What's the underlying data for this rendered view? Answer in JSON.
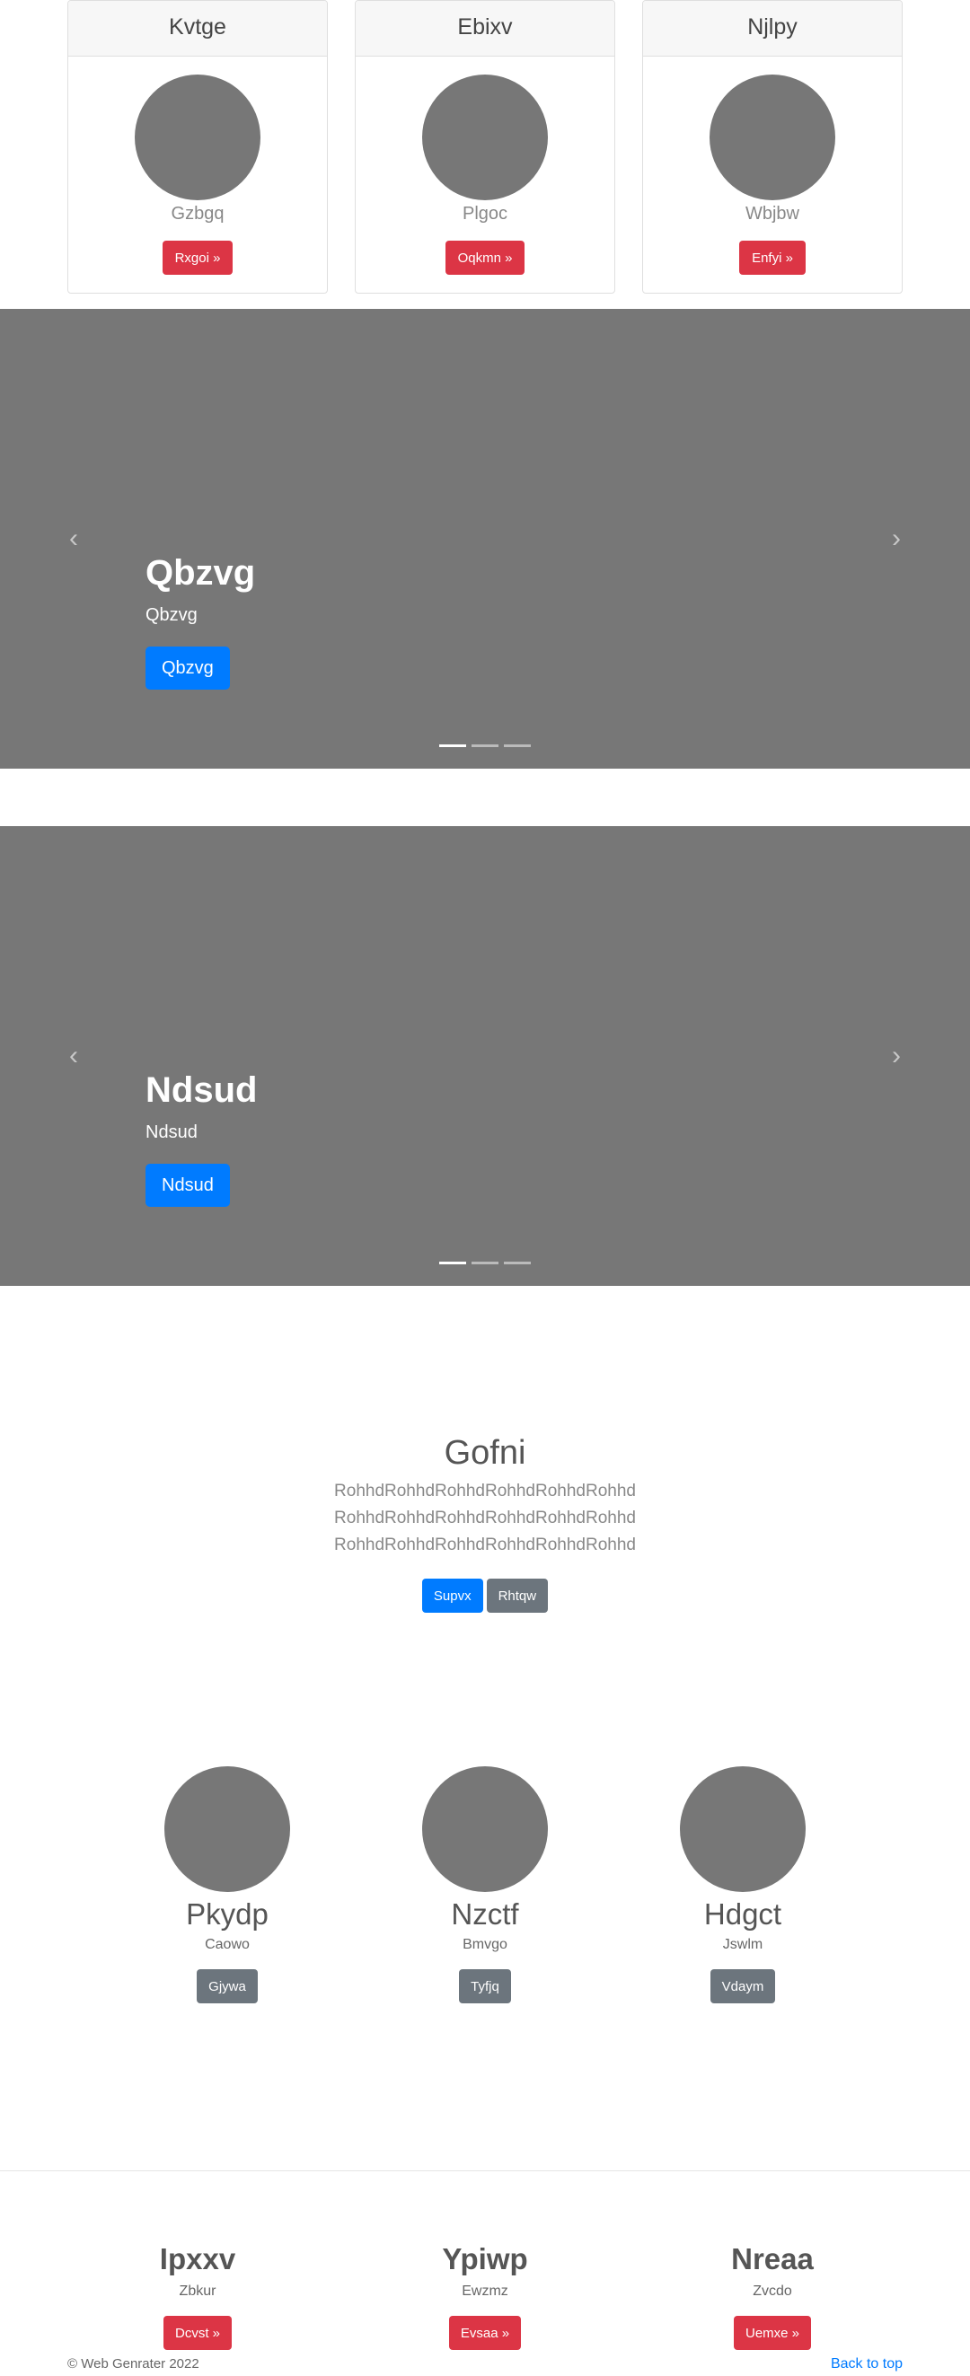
{
  "cards": [
    {
      "title": "Kvtge",
      "subtitle": "Gzbgq",
      "button": "Rxgoi »"
    },
    {
      "title": "Ebixv",
      "subtitle": "Plgoc",
      "button": "Oqkmn »"
    },
    {
      "title": "Njlpy",
      "subtitle": "Wbjbw",
      "button": "Enfyi »"
    }
  ],
  "carousel1": {
    "title": "Qbzvg",
    "subtitle": "Qbzvg",
    "button": "Qbzvg",
    "prev_icon": "‹",
    "next_icon": "›"
  },
  "carousel2": {
    "title": "Ndsud",
    "subtitle": "Ndsud",
    "button": "Ndsud",
    "prev_icon": "‹",
    "next_icon": "›"
  },
  "hero": {
    "title": "Gofni",
    "lines": [
      "RohhdRohhdRohhdRohhdRohhdRohhd",
      "RohhdRohhdRohhdRohhdRohhdRohhd",
      "RohhdRohhdRohhdRohhdRohhdRohhd"
    ],
    "primary_button": "Supvx",
    "secondary_button": "Rhtqw"
  },
  "people": [
    {
      "name": "Pkydp",
      "subtitle": "Caowo",
      "button": "Gjywa"
    },
    {
      "name": "Nzctf",
      "subtitle": "Bmvgo",
      "button": "Tyfjq"
    },
    {
      "name": "Hdgct",
      "subtitle": "Jswlm",
      "button": "Vdaym"
    }
  ],
  "bottom": [
    {
      "title": "Ipxxv",
      "subtitle": "Zbkur",
      "button": "Dcvst »"
    },
    {
      "title": "Ypiwp",
      "subtitle": "Ewzmz",
      "button": "Evsaa »"
    },
    {
      "title": "Nreaa",
      "subtitle": "Zvcdo",
      "button": "Uemxe »"
    }
  ],
  "footer": {
    "copyright": "© Web Genrater 2022",
    "back_to_top": "Back to top"
  },
  "colors": {
    "primary": "#007bff",
    "danger": "#dc3545",
    "secondary": "#6c757d",
    "placeholder": "#777777"
  }
}
